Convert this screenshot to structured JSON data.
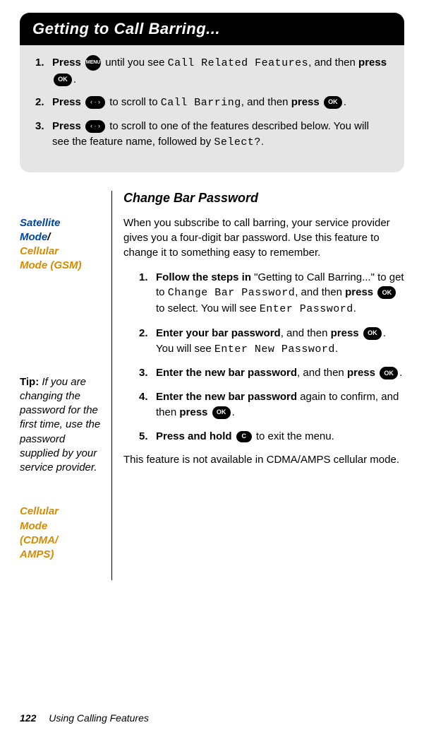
{
  "banner_title": "Getting to Call Barring...",
  "grey_steps": [
    {
      "num": "1.",
      "prefix_bold": "Press",
      "after_btn": " until you see ",
      "lcd": "Call Related Features",
      "after_lcd": ", and then ",
      "bold2": "press",
      "tail": "."
    },
    {
      "num": "2.",
      "prefix_bold": "Press",
      "after_btn": " to scroll to ",
      "lcd": "Call Barring",
      "after_lcd": ", and then ",
      "bold2": "press",
      "tail": "."
    },
    {
      "num": "3.",
      "prefix_bold": "Press",
      "after_btn": " to scroll to one of the features described below. You will see the feature name, followed by ",
      "lcd": "Select?",
      "tail": "."
    }
  ],
  "icons": {
    "menu": "MENU",
    "ok": "OK",
    "scroll_left_right": "‹ · ›",
    "c": "C"
  },
  "sidebar": {
    "mode1_line1": "Satellite",
    "mode1_line2": "Mode",
    "mode_sep": "/",
    "mode1_line3": "Cellular",
    "mode1_line4": "Mode (GSM)",
    "tip_label": "Tip:",
    "tip_body": " If you are changing the password for the first time, use the password supplied by your service provider.",
    "mode2_line1": "Cellular",
    "mode2_line2": "Mode",
    "mode2_line3": "(CDMA/",
    "mode2_line4": "AMPS)"
  },
  "main": {
    "section_title": "Change Bar Password",
    "intro": "When you subscribe to call barring, your service provider gives you a four-digit bar password. Use this feature to change it to something easy to remember.",
    "steps": [
      {
        "num": "1.",
        "bold": "Follow the steps in",
        "txt1": " \"Getting to Call Barring...\" to get to ",
        "lcd1": "Change Bar Password",
        "txt2": ", and then ",
        "bold2": "press",
        "txt3": " to select. You will see ",
        "lcd2": "Enter Password",
        "tail": "."
      },
      {
        "num": "2.",
        "bold": "Enter your bar password",
        "txt1": ", and then ",
        "bold2": "press",
        "txt2": ". You will see ",
        "lcd1": "Enter New Password",
        "tail": "."
      },
      {
        "num": "3.",
        "bold": "Enter the new bar password",
        "txt1": ", and then ",
        "bold2": "press",
        "tail": "."
      },
      {
        "num": "4.",
        "bold": "Enter the new bar password",
        "txt1": " again to confirm, and then ",
        "bold2": "press",
        "tail": "."
      },
      {
        "num": "5.",
        "bold": "Press and hold",
        "txt1": " to exit the menu."
      }
    ],
    "cdma_note": "This feature is not available in CDMA/AMPS cellular mode."
  },
  "footer": {
    "page": "122",
    "chapter": "Using Calling Features"
  }
}
